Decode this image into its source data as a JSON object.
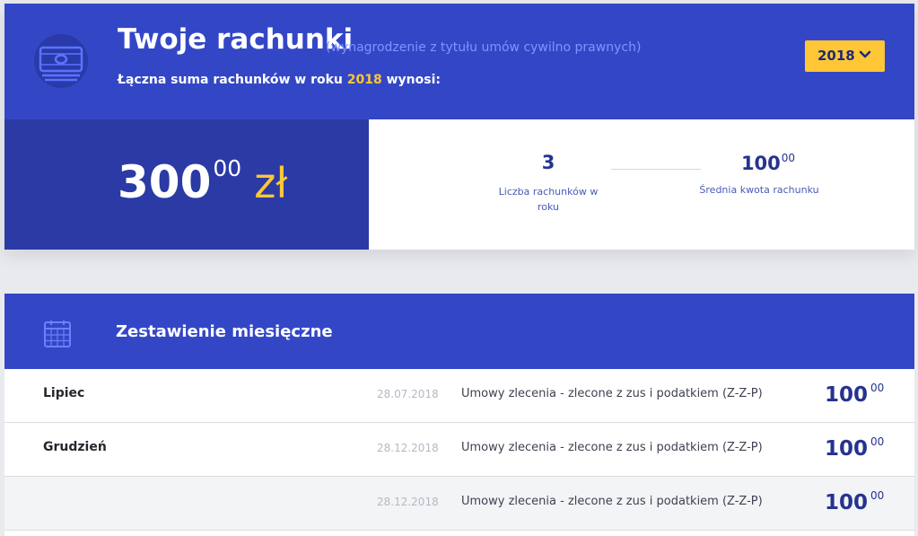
{
  "header": {
    "title": "Twoje rachunki",
    "subtitle": "(wynagrodzenie z tytułu umów cywilno prawnych)",
    "summary_prefix": "Łączna suma rachunków w roku",
    "summary_year": "2018",
    "summary_suffix": "wynosi:",
    "icon": "money-icon"
  },
  "year_select": {
    "value": "2018",
    "icon": "chevron-down-icon"
  },
  "total": {
    "integer": "300",
    "decimal": "00",
    "currency": "zł"
  },
  "stats": {
    "count_value": "3",
    "count_label": "Liczba rachunków w roku",
    "avg_integer": "100",
    "avg_decimal": "00",
    "avg_label": "Średnia kwota rachunku"
  },
  "monthly": {
    "title": "Zestawienie miesięczne",
    "icon": "calendar-icon",
    "rows": [
      {
        "month": "Lipiec",
        "date": "28.07.2018",
        "description": "Umowy zlecenia - zlecone z zus i podatkiem (Z-Z-P)",
        "amount_integer": "100",
        "amount_decimal": "00"
      },
      {
        "month": "Grudzień",
        "date": "28.12.2018",
        "description": "Umowy zlecenia - zlecone z zus i podatkiem (Z-Z-P)",
        "amount_integer": "100",
        "amount_decimal": "00"
      },
      {
        "month": "",
        "date": "28.12.2018",
        "description": "Umowy zlecenia - zlecone z zus i podatkiem (Z-Z-P)",
        "amount_integer": "100",
        "amount_decimal": "00"
      }
    ]
  },
  "colors": {
    "primary": "#3347c6",
    "primary_dark": "#2b3aa5",
    "accent": "#ffc635",
    "navy_text": "#26338f"
  }
}
